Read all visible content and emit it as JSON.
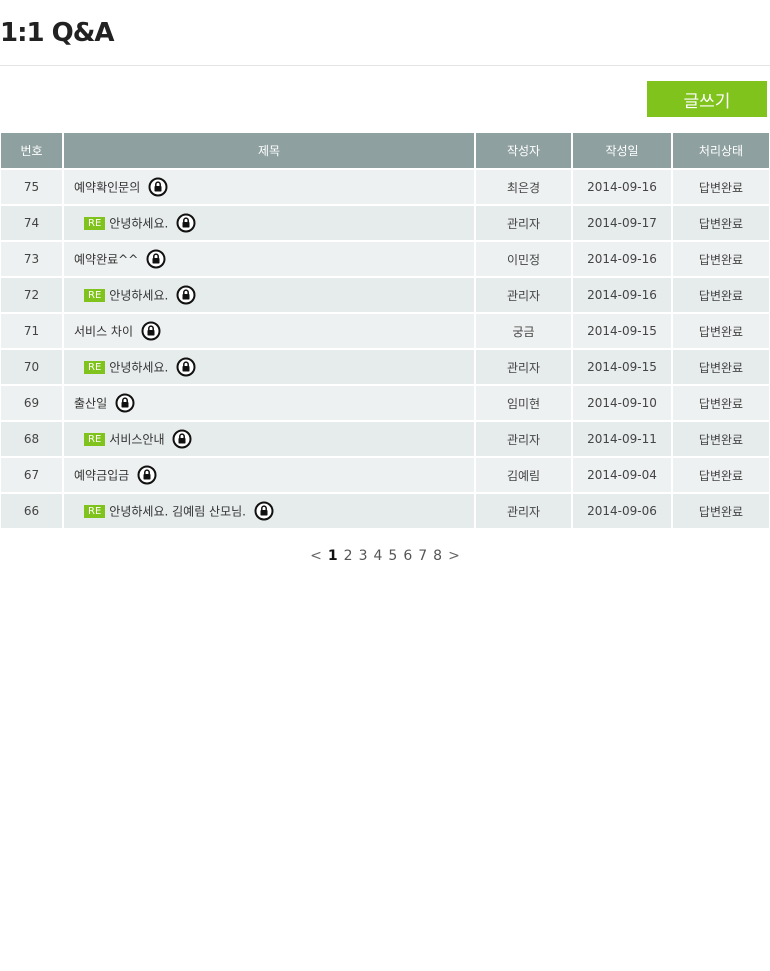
{
  "page": {
    "title": "1:1 Q&A"
  },
  "toolbar": {
    "write_label": "글쓰기"
  },
  "table": {
    "headers": {
      "no": "번호",
      "subject": "제목",
      "author": "작성자",
      "date": "작성일",
      "status": "처리상태"
    },
    "rows": [
      {
        "no": "75",
        "reply": false,
        "subject": "예약확인문의",
        "author": "최은경",
        "date": "2014-09-16",
        "status": "답변완료"
      },
      {
        "no": "74",
        "reply": true,
        "re": "RE",
        "subject": "안녕하세요.",
        "author": "관리자",
        "date": "2014-09-17",
        "status": "답변완료"
      },
      {
        "no": "73",
        "reply": false,
        "subject": "예약완료^^",
        "author": "이민정",
        "date": "2014-09-16",
        "status": "답변완료"
      },
      {
        "no": "72",
        "reply": true,
        "re": "RE",
        "subject": "안녕하세요.",
        "author": "관리자",
        "date": "2014-09-16",
        "status": "답변완료"
      },
      {
        "no": "71",
        "reply": false,
        "subject": "서비스 차이",
        "author": "궁금",
        "date": "2014-09-15",
        "status": "답변완료"
      },
      {
        "no": "70",
        "reply": true,
        "re": "RE",
        "subject": "안녕하세요.",
        "author": "관리자",
        "date": "2014-09-15",
        "status": "답변완료"
      },
      {
        "no": "69",
        "reply": false,
        "subject": "출산일",
        "author": "임미현",
        "date": "2014-09-10",
        "status": "답변완료"
      },
      {
        "no": "68",
        "reply": true,
        "re": "RE",
        "subject": "서비스안내",
        "author": "관리자",
        "date": "2014-09-11",
        "status": "답변완료"
      },
      {
        "no": "67",
        "reply": false,
        "subject": "예약금입금",
        "author": "김예림",
        "date": "2014-09-04",
        "status": "답변완료"
      },
      {
        "no": "66",
        "reply": true,
        "re": "RE",
        "subject": "안녕하세요. 김예림 산모님.",
        "author": "관리자",
        "date": "2014-09-06",
        "status": "답변완료"
      }
    ]
  },
  "pagination": {
    "prev": "<",
    "next": ">",
    "pages": [
      "1",
      "2",
      "3",
      "4",
      "5",
      "6",
      "7",
      "8"
    ],
    "current": "1"
  },
  "colors": {
    "accent": "#7fc31c",
    "header_bg": "#8fa0a0",
    "row_bg": "#eef1f1"
  },
  "icons": {
    "lock": "lock-icon"
  }
}
